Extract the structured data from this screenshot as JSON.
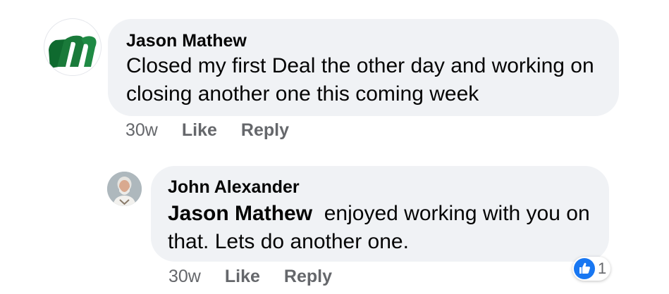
{
  "comments": [
    {
      "author": "Jason Mathew",
      "text": "Closed my first Deal the other day and working on closing another one this coming week",
      "time": "30w",
      "like_label": "Like",
      "reply_label": "Reply",
      "avatar_icon": "m-logo-avatar"
    },
    {
      "author": "John Alexander",
      "mention": "Jason Mathew",
      "text": "enjoyed working with you on that. Lets do another one.",
      "time": "30w",
      "like_label": "Like",
      "reply_label": "Reply",
      "avatar_icon": "profile-photo-avatar",
      "reaction": {
        "icon": "thumbs-up-icon",
        "count": "1"
      }
    }
  ],
  "colors": {
    "bubble": "#f0f2f5",
    "meta_text": "#65676b",
    "like_blue": "#1877f2",
    "logo_green": "#1a7a3a"
  }
}
